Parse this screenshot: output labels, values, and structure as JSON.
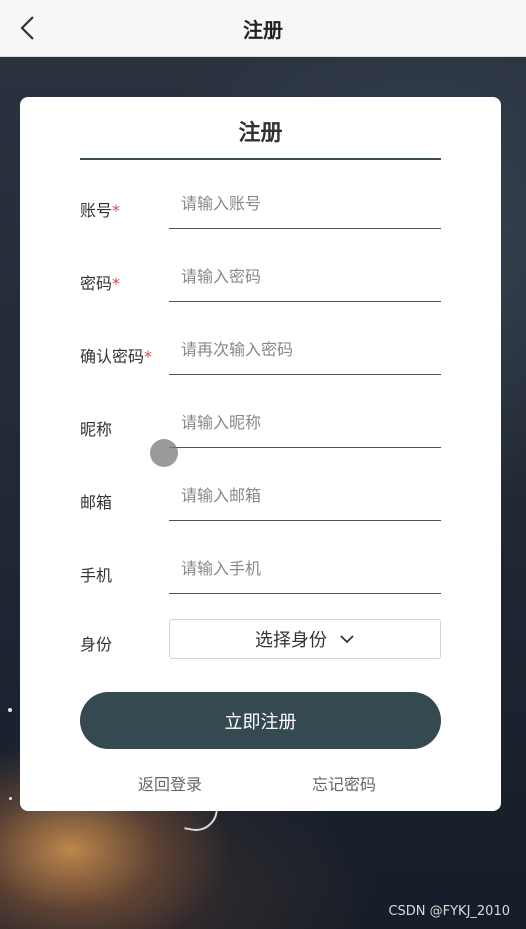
{
  "header": {
    "title": "注册",
    "back_icon": "chevron-left-icon"
  },
  "form": {
    "title": "注册",
    "required_mark": "*",
    "fields": [
      {
        "label": "账号",
        "required": true,
        "placeholder": "请输入账号",
        "value": ""
      },
      {
        "label": "密码",
        "required": true,
        "placeholder": "请输入密码",
        "value": ""
      },
      {
        "label": "确认密码",
        "required": true,
        "placeholder": "请再次输入密码",
        "value": ""
      },
      {
        "label": "昵称",
        "required": false,
        "placeholder": "请输入昵称",
        "value": ""
      },
      {
        "label": "邮箱",
        "required": false,
        "placeholder": "请输入邮箱",
        "value": ""
      },
      {
        "label": "手机",
        "required": false,
        "placeholder": "请输入手机",
        "value": ""
      }
    ],
    "role": {
      "label": "身份",
      "selected": "选择身份",
      "icon": "chevron-down-icon"
    },
    "submit_label": "立即注册",
    "back_to_login": "返回登录",
    "forgot_password": "忘记密码"
  },
  "watermark": "CSDN @FYKJ_2010",
  "colors": {
    "accent": "#354a50",
    "required": "#e04a4a",
    "header_bg": "#f7f7f7"
  }
}
